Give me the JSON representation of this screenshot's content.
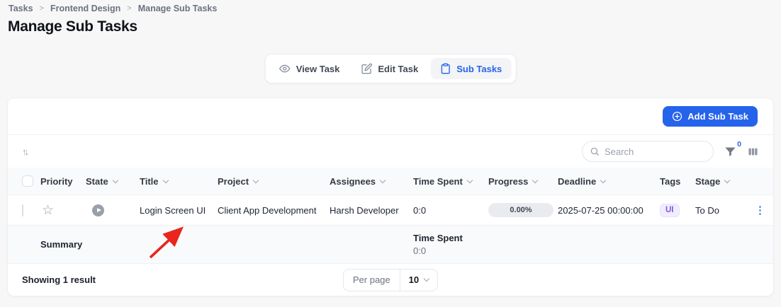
{
  "breadcrumb": {
    "separator": ">",
    "items": [
      "Tasks",
      "Frontend Design",
      "Manage Sub Tasks"
    ]
  },
  "header": {
    "title": "Manage Sub Tasks"
  },
  "tabs": {
    "items": [
      {
        "label": "View Task",
        "icon": "eye-icon",
        "active": false
      },
      {
        "label": "Edit Task",
        "icon": "edit-icon",
        "active": false
      },
      {
        "label": "Sub Tasks",
        "icon": "clipboard-icon",
        "active": true
      }
    ]
  },
  "toolbar": {
    "add_button_label": "Add Sub Task",
    "search_placeholder": "Search",
    "filter_count": "0"
  },
  "table": {
    "columns": [
      {
        "label": "Priority",
        "sortable": false
      },
      {
        "label": "State",
        "sortable": true
      },
      {
        "label": "Title",
        "sortable": true
      },
      {
        "label": "Project",
        "sortable": true
      },
      {
        "label": "Assignees",
        "sortable": true
      },
      {
        "label": "Time Spent",
        "sortable": true
      },
      {
        "label": "Progress",
        "sortable": true
      },
      {
        "label": "Deadline",
        "sortable": true
      },
      {
        "label": "Tags",
        "sortable": false
      },
      {
        "label": "Stage",
        "sortable": true
      }
    ],
    "rows": [
      {
        "title": "Login Screen UI",
        "project": "Client App Development",
        "assignees": "Harsh Developer",
        "time_spent": "0:0",
        "progress": "0.00%",
        "deadline": "2025-07-25 00:00:00",
        "tags": [
          "UI"
        ],
        "stage": "To Do"
      }
    ],
    "summary": {
      "label": "Summary",
      "time_spent_label": "Time Spent",
      "time_spent_value": "0:0"
    }
  },
  "footer": {
    "results_text": "Showing 1 result",
    "per_page_label": "Per page",
    "per_page_value": "10"
  },
  "colors": {
    "accent": "#2563eb",
    "tag_bg": "#f2edfd",
    "tag_text": "#7e57e2",
    "progress_pill_bg": "#e9ebef",
    "annotation_arrow": "#e8261d"
  }
}
